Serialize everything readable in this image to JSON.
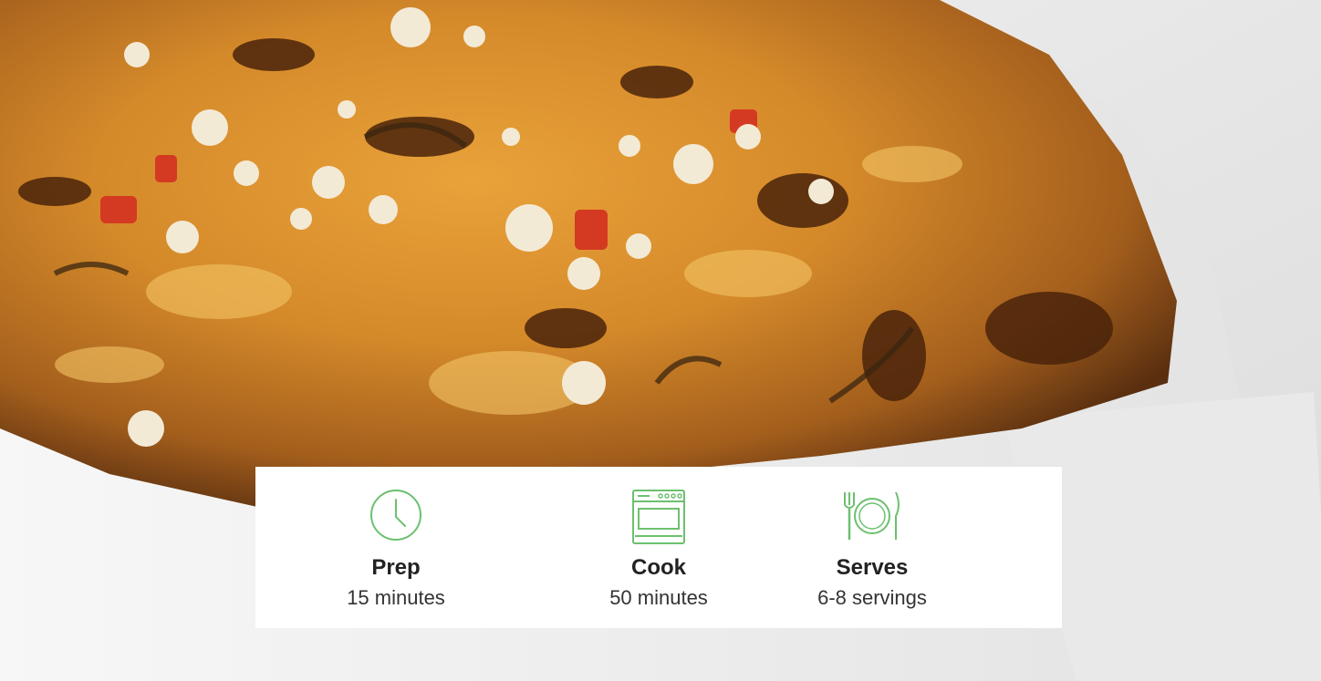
{
  "hero": {
    "image_subject": "baked-pasta-casserole-photo"
  },
  "colors": {
    "accent": "#6cc06f",
    "card_background": "#ffffff",
    "label_text": "#222222",
    "value_text": "#333333"
  },
  "info": {
    "prep": {
      "icon": "clock-icon",
      "label": "Prep",
      "value": "15 minutes"
    },
    "cook": {
      "icon": "oven-icon",
      "label": "Cook",
      "value": "50 minutes"
    },
    "serves": {
      "icon": "plate-cutlery-icon",
      "label": "Serves",
      "value": "6-8 servings"
    }
  }
}
